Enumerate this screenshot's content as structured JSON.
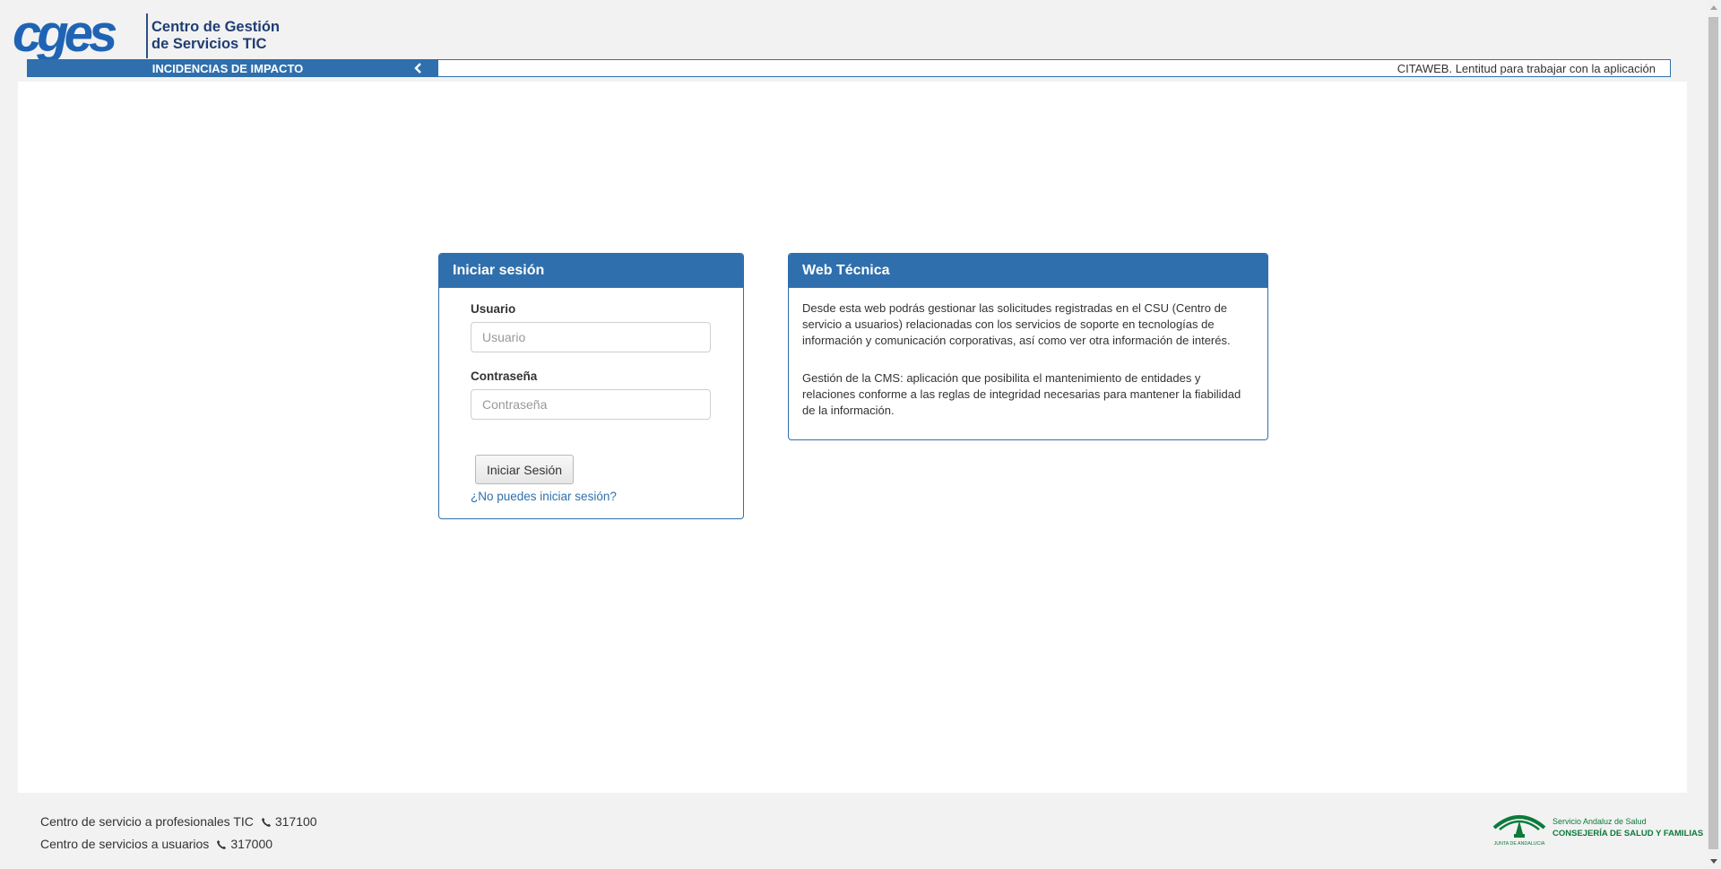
{
  "header": {
    "logo_text": "cges",
    "org_line1": "Centro de Gestión",
    "org_line2": "de Servicios TIC"
  },
  "ticker": {
    "label": "INCIDENCIAS DE IMPACTO",
    "message": "CITAWEB. Lentitud para trabajar con la aplicación"
  },
  "login": {
    "title": "Iniciar sesión",
    "user_label": "Usuario",
    "user_placeholder": "Usuario",
    "password_label": "Contraseña",
    "password_placeholder": "Contraseña",
    "submit_label": "Iniciar Sesión",
    "help_link": "¿No puedes iniciar sesión?"
  },
  "info": {
    "title": "Web Técnica",
    "paragraph1": "Desde esta web podrás gestionar las solicitudes registradas en el CSU (Centro de servicio a usuarios) relacionadas con los servicios de soporte en tecnologías de información y comunicación corporativas, así como ver otra información de interés.",
    "paragraph2": "Gestión de la CMS: aplicación que posibilita el mantenimiento de entidades y relaciones conforme a las reglas de integridad necesarias para mantener la fiabilidad de la información."
  },
  "footer": {
    "line1_text": "Centro de servicio a profesionales TIC",
    "line1_phone": "317100",
    "line2_text": "Centro de servicios a usuarios",
    "line2_phone": "317000"
  },
  "junta": {
    "left_text": "JUNTA DE ANDALUCIA",
    "right_line1": "Servicio Andaluz de Salud",
    "right_line2": "CONSEJERÍA DE SALUD Y FAMILIAS"
  },
  "colors": {
    "primary": "#2f6fad",
    "logo_blue": "#1f3e73",
    "junta_green": "#0b7a3b"
  }
}
